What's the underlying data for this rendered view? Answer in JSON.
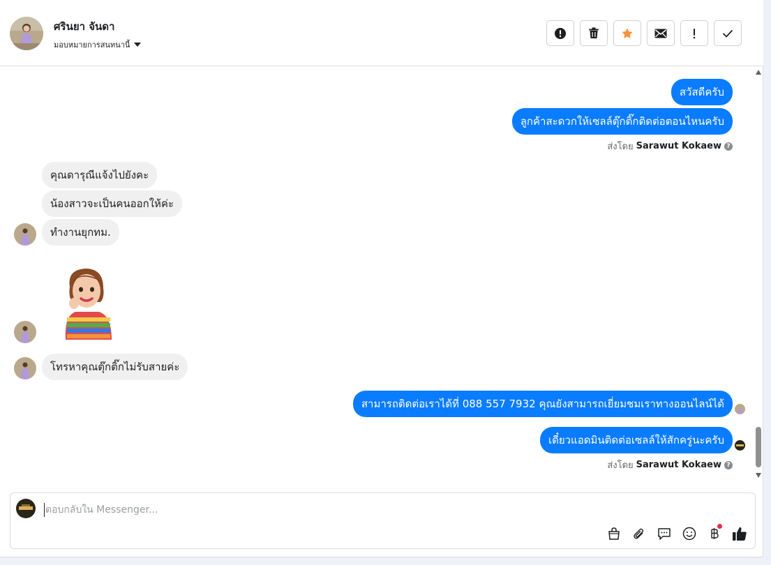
{
  "header": {
    "contact_name": "ศรินยา จันดา",
    "assign_label": "มอบหมายการสนทนานี้",
    "actions": [
      {
        "icon": "alert-circle-icon"
      },
      {
        "icon": "trash-icon"
      },
      {
        "icon": "star-icon"
      },
      {
        "icon": "envelope-icon"
      },
      {
        "icon": "exclamation-icon"
      },
      {
        "icon": "check-icon"
      }
    ]
  },
  "thread": {
    "cut_label": "· · · ·",
    "messages": [
      {
        "dir": "out",
        "text": "สวัสดีครับ"
      },
      {
        "dir": "out",
        "text": "ลูกค้าสะดวกให้เซลล์ตุ๊กติ๊กติดต่อตอนไหนครับ"
      },
      {
        "dir": "in",
        "text": "คุณดารุณีแจ้งไปยังคะ"
      },
      {
        "dir": "in",
        "text": "น้องสาวจะเป็นคนออกให้ค่ะ"
      },
      {
        "dir": "in",
        "text": "ทำงานยุกทม."
      },
      {
        "dir": "in",
        "text": "โทรหาคุณตุ๊กติ๊กไม่รับสายค่ะ"
      },
      {
        "dir": "out",
        "text": "สามารถติดต่อเราได้ที่ 088 557 7932 คุณยังสามารถเยี่ยมชมเราทางออนไลน์ได้"
      },
      {
        "dir": "out",
        "text": "เดี๋ยวแอดมินติดต่อเซลล์ให้สักครู่นะครับ"
      }
    ],
    "sent_by_prefix": "ส่งโดย",
    "sent_by_name": "Sarawut Kokaew",
    "sent_by_help": "?"
  },
  "composer": {
    "placeholder": "ตอบกลับใน Messenger...",
    "tools": [
      {
        "icon": "shopping-bag-icon"
      },
      {
        "icon": "paperclip-icon"
      },
      {
        "icon": "chat-bubble-icon"
      },
      {
        "icon": "smiley-icon"
      },
      {
        "icon": "baht-icon",
        "badge": true
      },
      {
        "icon": "thumbs-up-icon"
      }
    ]
  },
  "colors": {
    "outgoing": "#0a7cff",
    "incoming": "#f0f0f0",
    "star": "#f7923a",
    "badge": "#f02849"
  }
}
